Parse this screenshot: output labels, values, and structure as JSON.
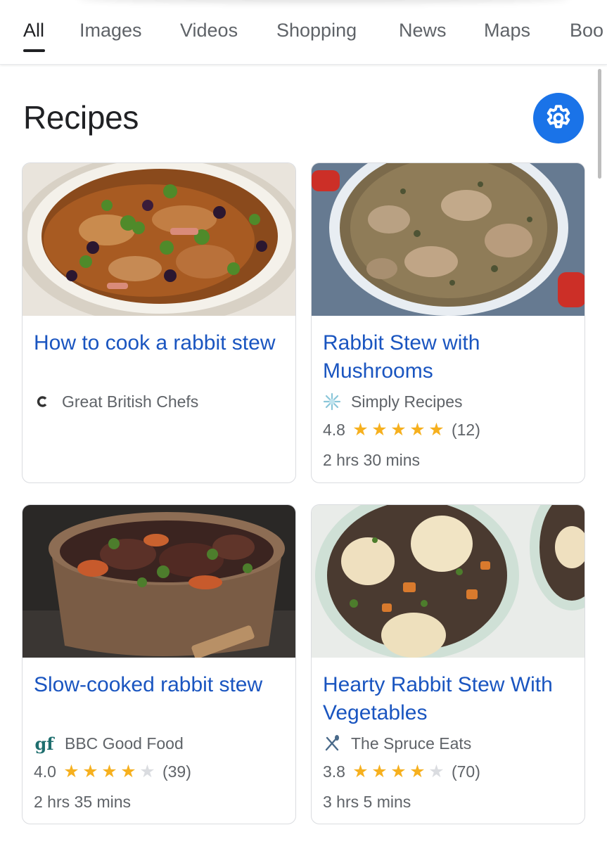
{
  "tabs": [
    {
      "label": "All",
      "active": true
    },
    {
      "label": "Images"
    },
    {
      "label": "Videos"
    },
    {
      "label": "Shopping"
    },
    {
      "label": "News"
    },
    {
      "label": "Maps"
    },
    {
      "label": "Boo"
    }
  ],
  "section": {
    "title": "Recipes",
    "settings_icon": "gear-icon"
  },
  "colors": {
    "link": "#1a55c0",
    "accent": "#1a73e8",
    "star": "#f6b01e"
  },
  "recipes": [
    {
      "title": "How to cook a rabbit stew",
      "source": "Great British Chefs",
      "source_icon": "great-british-chefs-logo-icon",
      "image": "rabbit-stew-with-olives-and-herbs-in-bowl"
    },
    {
      "title": "Rabbit Stew with Mushrooms",
      "source": "Simply Recipes",
      "source_icon": "simply-recipes-logo-icon",
      "rating": "4.8",
      "rating_value": 4.8,
      "review_count": "(12)",
      "duration": "2 hrs 30 mins",
      "image": "rabbit-stew-in-red-dutch-oven"
    },
    {
      "title": "Slow-cooked rabbit stew",
      "source": "BBC Good Food",
      "source_icon": "bbc-good-food-logo-icon",
      "rating": "4.0",
      "rating_value": 4.0,
      "review_count": "(39)",
      "duration": "2 hrs 35 mins",
      "image": "rabbit-stew-in-copper-pot"
    },
    {
      "title": "Hearty Rabbit Stew With Vegetables",
      "source": "The Spruce Eats",
      "source_icon": "spruce-eats-logo-icon",
      "rating": "3.8",
      "rating_value": 3.8,
      "review_count": "(70)",
      "duration": "3 hrs 5 mins",
      "image": "rabbit-stew-with-dumplings-in-bowls"
    }
  ]
}
